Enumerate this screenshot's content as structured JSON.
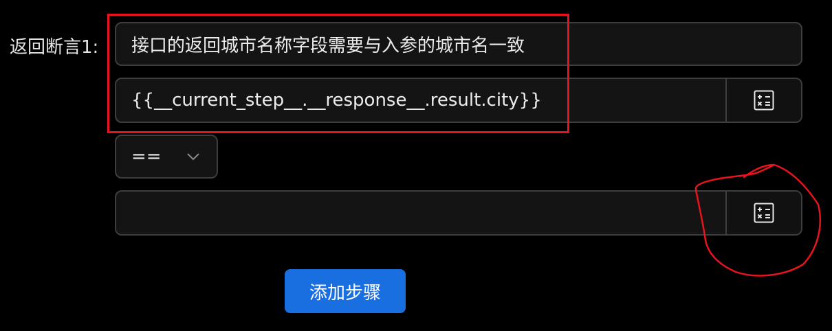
{
  "assertion": {
    "label": "返回断言1:",
    "description": "接口的返回城市名称字段需要与入参的城市名一致",
    "expression": "{{__current_step__.__response__.result.city}}",
    "operator": "==",
    "expected_value": ""
  },
  "actions": {
    "add_step_label": "添加步骤"
  },
  "icons": {
    "calculator": "calculator-icon",
    "chevron": "chevron-down-icon"
  },
  "colors": {
    "background": "#000000",
    "primary": "#1a6fe0",
    "annotation": "#e8131c"
  }
}
